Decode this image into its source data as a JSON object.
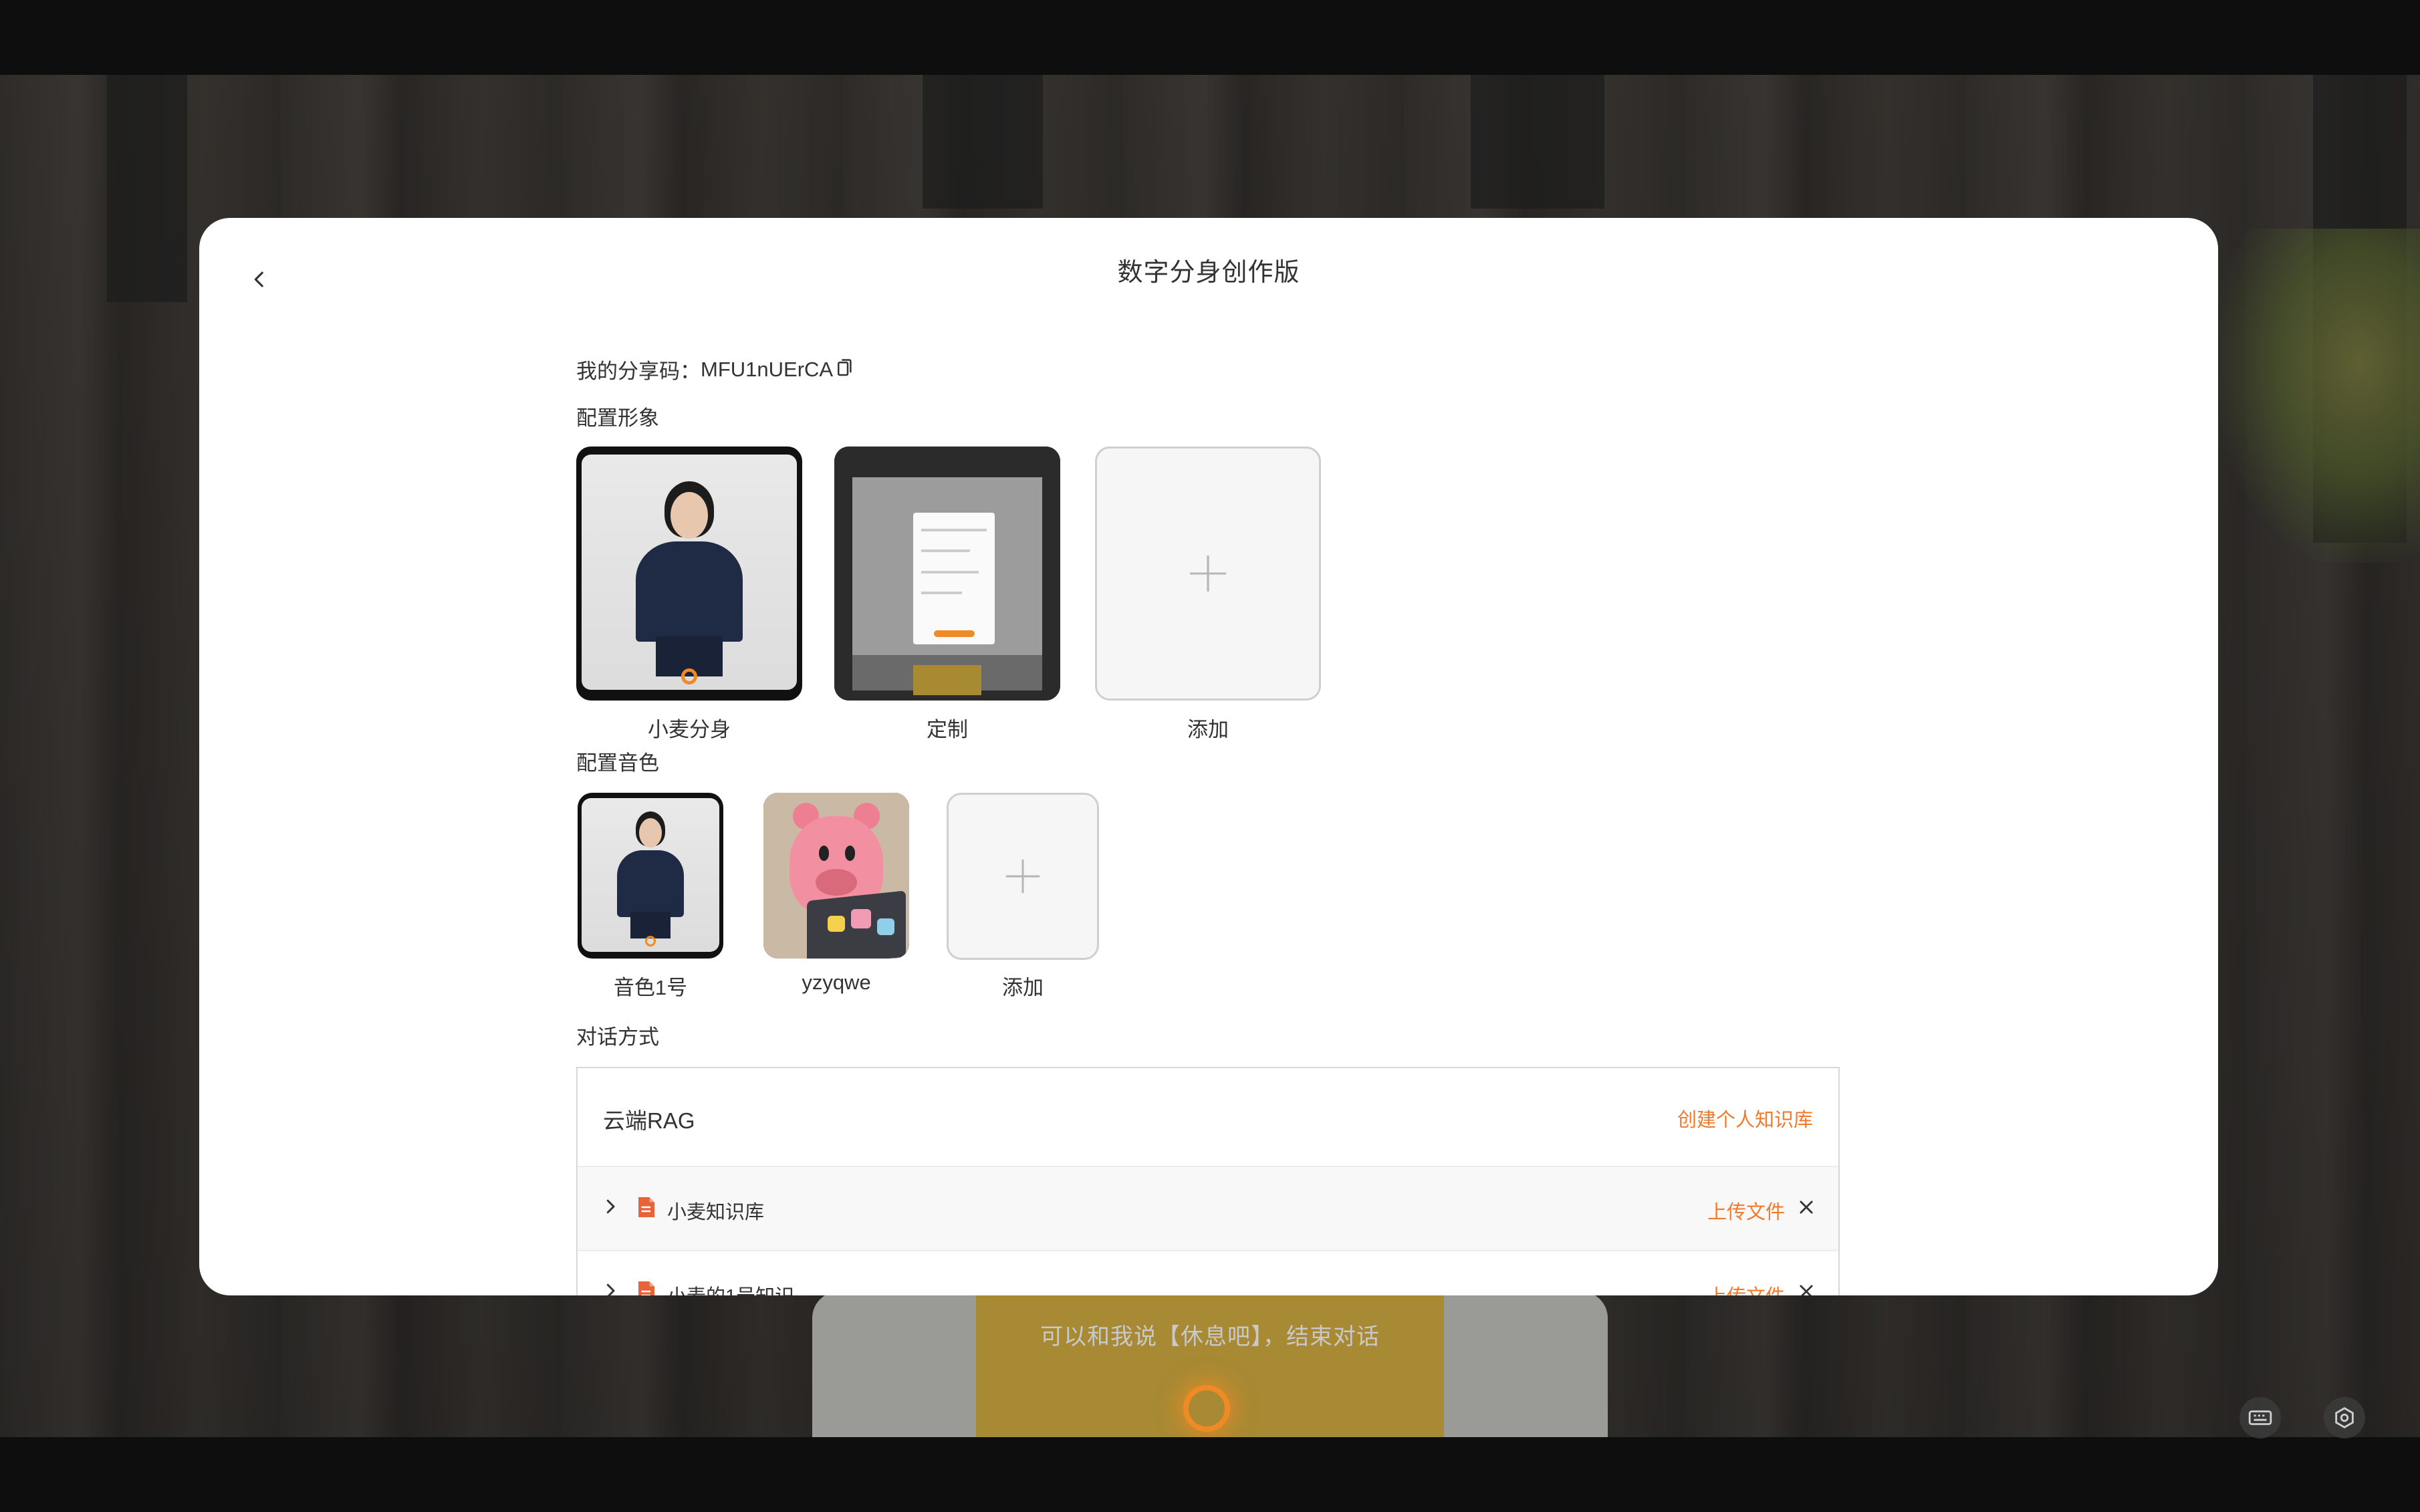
{
  "modal": {
    "title": "数字分身创作版",
    "share_prefix": "我的分享码：",
    "share_code": "MFU1nUErCA"
  },
  "sections": {
    "appearance": "配置形象",
    "voice": "配置音色",
    "dialog": "对话方式"
  },
  "appearance_items": [
    {
      "label": "小麦分身",
      "type": "avatar"
    },
    {
      "label": "定制",
      "type": "screenshot"
    },
    {
      "label": "添加",
      "type": "add"
    }
  ],
  "voice_items": [
    {
      "label": "音色1号",
      "type": "avatar"
    },
    {
      "label": "yzyqwe",
      "type": "pig"
    },
    {
      "label": "添加",
      "type": "add"
    }
  ],
  "rag": {
    "title": "云端RAG",
    "create_label": "创建个人知识库",
    "knowledge_bases": [
      {
        "name": "小麦知识库",
        "upload_label": "上传文件"
      },
      {
        "name": "小麦的1号知识",
        "upload_label": "上传文件"
      }
    ]
  },
  "background": {
    "caption": "可以和我说【休息吧】，结束对话"
  },
  "icons": {
    "back": "chevron-left-icon",
    "copy": "copy-icon",
    "add": "plus-icon",
    "expand": "chevron-right-icon",
    "document": "document-icon",
    "remove": "close-icon",
    "keyboard": "keyboard-icon",
    "settings": "settings-icon"
  },
  "colors": {
    "accent": "#f07a2c",
    "document_icon": "#e8633a",
    "orb": "#f08a24"
  }
}
